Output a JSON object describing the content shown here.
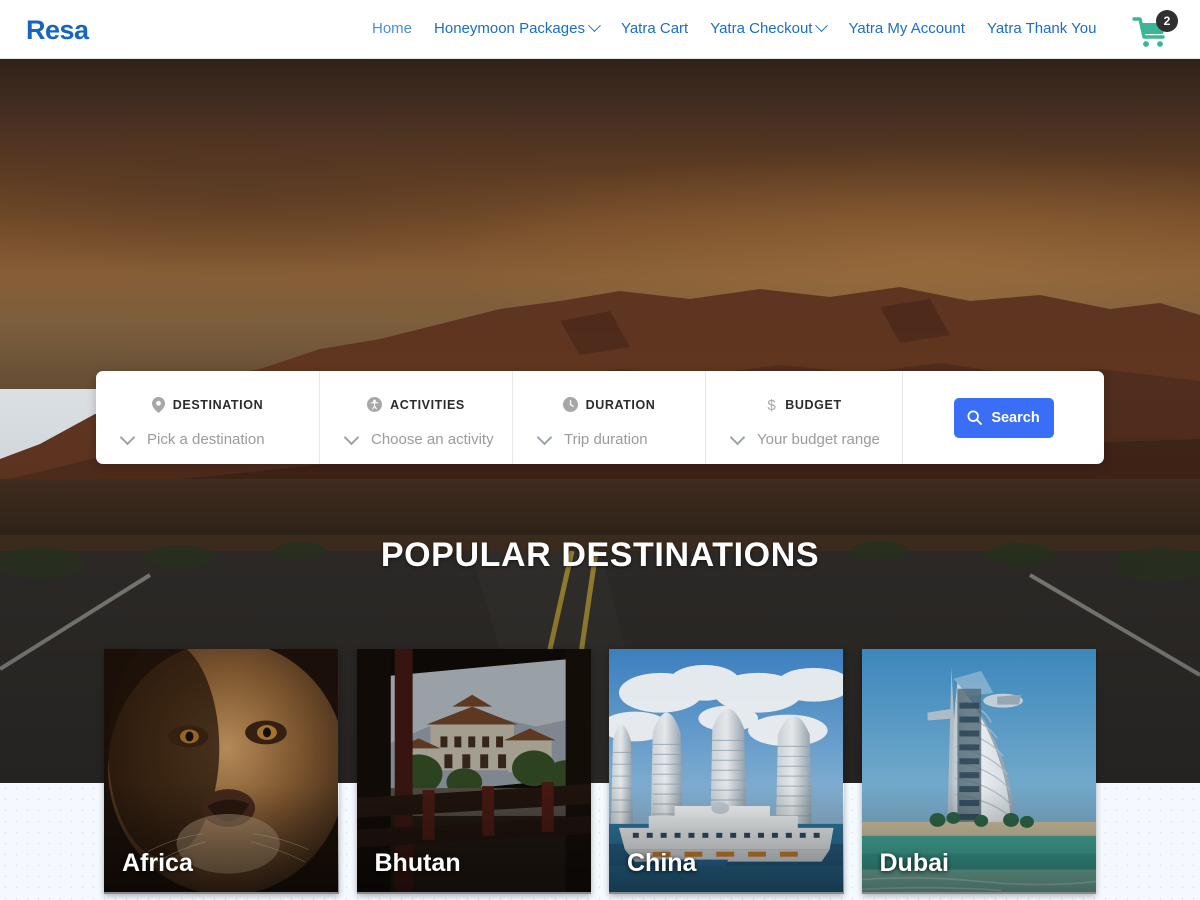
{
  "header": {
    "brand": "Resa",
    "nav": [
      {
        "label": "Home",
        "active": true,
        "caret": false
      },
      {
        "label": "Honeymoon Packages",
        "active": false,
        "caret": true
      },
      {
        "label": "Yatra Cart",
        "active": false,
        "caret": false
      },
      {
        "label": "Yatra Checkout",
        "active": false,
        "caret": true
      },
      {
        "label": "Yatra My Account",
        "active": false,
        "caret": false
      },
      {
        "label": "Yatra Thank You",
        "active": false,
        "caret": false
      }
    ],
    "cart": {
      "icon": "shopping-cart-icon",
      "count": "2",
      "color": "#3ab795"
    }
  },
  "search": {
    "fields": [
      {
        "icon": "map-pin-icon",
        "label": "DESTINATION",
        "placeholder": "Pick a destination",
        "value": ""
      },
      {
        "icon": "activity-person-icon",
        "label": "ACTIVITIES",
        "placeholder": "Choose an activity",
        "value": ""
      },
      {
        "icon": "clock-icon",
        "label": "DURATION",
        "placeholder": "Trip duration",
        "value": ""
      },
      {
        "icon": "dollar-icon",
        "label": "BUDGET",
        "placeholder": "Your budget range",
        "value": ""
      }
    ],
    "button": {
      "label": "Search",
      "icon": "search-icon",
      "color": "#3b6ef6"
    }
  },
  "section": {
    "title": "POPULAR DESTINATIONS"
  },
  "destinations": [
    {
      "title": "Africa",
      "image": "lion-close-up"
    },
    {
      "title": "Bhutan",
      "image": "punakha-dzong-from-bridge"
    },
    {
      "title": "China",
      "image": "sanya-phoenix-island-towers-cruise-ship"
    },
    {
      "title": "Dubai",
      "image": "burj-al-arab-hotel"
    }
  ],
  "colors": {
    "brand": "#1665c0",
    "nav_link": "#1a6fc4",
    "nav_active": "#4a8fd9",
    "accent_button": "#3b6ef6",
    "cart": "#3ab795",
    "page_bg": "#f4faff"
  }
}
